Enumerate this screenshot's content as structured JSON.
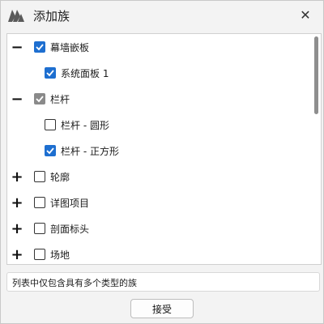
{
  "window": {
    "title": "添加族",
    "close_glyph": "✕"
  },
  "tree": {
    "items": [
      {
        "label": "幕墙嵌板",
        "expander": "−",
        "checked": true,
        "state": "checked"
      },
      {
        "label": "系统面板 1",
        "expander": "",
        "checked": true,
        "state": "checked"
      },
      {
        "label": "栏杆",
        "expander": "−",
        "checked": true,
        "state": "partial"
      },
      {
        "label": "栏杆 - 圆形",
        "expander": "",
        "checked": false,
        "state": "unchecked"
      },
      {
        "label": "栏杆 - 正方形",
        "expander": "",
        "checked": true,
        "state": "checked"
      },
      {
        "label": "轮廓",
        "expander": "+",
        "checked": false,
        "state": "unchecked"
      },
      {
        "label": "详图项目",
        "expander": "+",
        "checked": false,
        "state": "unchecked"
      },
      {
        "label": "剖面标头",
        "expander": "+",
        "checked": false,
        "state": "unchecked"
      },
      {
        "label": "场地",
        "expander": "+",
        "checked": false,
        "state": "unchecked"
      }
    ]
  },
  "status": {
    "text": "列表中仅包含具有多个类型的族"
  },
  "buttons": {
    "accept_label": "接受"
  },
  "colors": {
    "check_blue": "#1e6fd0",
    "check_gray": "#8a8a8a"
  }
}
